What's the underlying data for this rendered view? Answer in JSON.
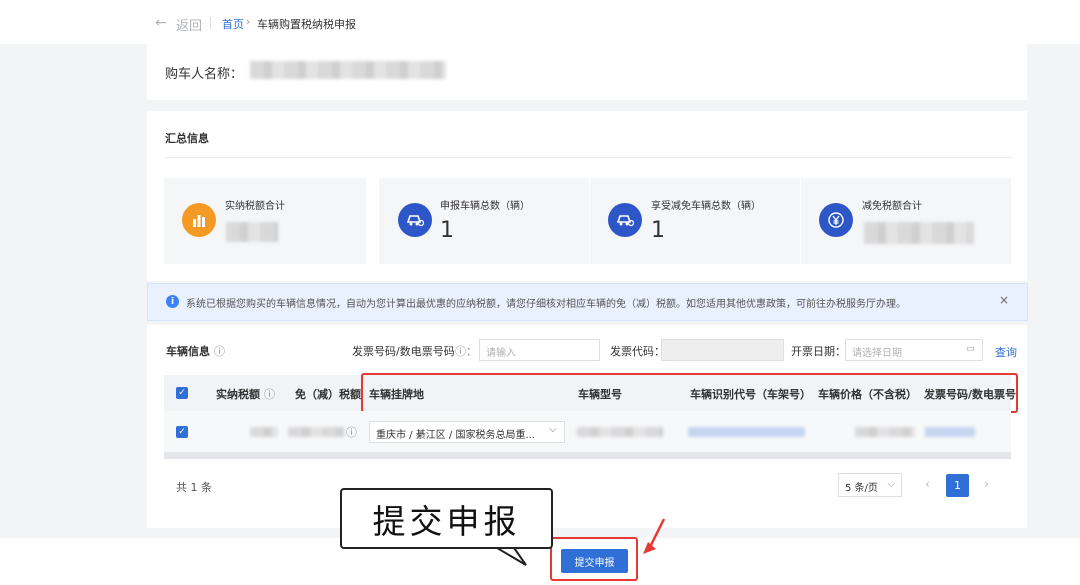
{
  "topbar": {
    "back_label": "返回",
    "breadcrumb": {
      "home": "首页",
      "separator": "›",
      "current": "车辆购置税纳税申报"
    }
  },
  "buyer": {
    "label": "购车人名称："
  },
  "summary": {
    "title": "汇总信息",
    "stats": [
      {
        "label": "实纳税额合计",
        "value": "",
        "icon": "chart-icon",
        "color": "#f39a24"
      },
      {
        "label": "申报车辆总数（辆）",
        "value": "1",
        "icon": "car-icon",
        "color": "#2d57c9"
      },
      {
        "label": "享受减免车辆总数（辆）",
        "value": "1",
        "icon": "car-discount-icon",
        "color": "#2d57c9"
      },
      {
        "label": "减免税额合计",
        "value": "",
        "icon": "yen-icon",
        "color": "#2d57c9"
      }
    ]
  },
  "notice": {
    "text": "系统已根据您购买的车辆信息情况，自动为您计算出最优惠的应纳税额，请您仔细核对相应车辆的免（减）税额。如您适用其他优惠政策，可前往办税服务厅办理。",
    "close": "×"
  },
  "vehicle": {
    "title": "车辆信息",
    "filters": {
      "invoice_no_label": "发票号码/数电票号码",
      "invoice_no_placeholder": "请输入",
      "invoice_code_label": "发票代码：",
      "date_label": "开票日期：",
      "date_placeholder": "请选择日期",
      "query": "查询"
    },
    "columns": [
      "实纳税额",
      "免（减）税额",
      "车辆挂牌地",
      "车辆型号",
      "车辆识别代号（车架号）",
      "车辆价格（不含税）",
      "发票号码/数电票号"
    ],
    "row": {
      "plate_location": "重庆市 / 綦江区 / 国家税务总局重..."
    },
    "total": "共 1 条",
    "page_size": "5 条/页",
    "current_page": "1"
  },
  "actions": {
    "submit": "提交申报"
  },
  "callout": {
    "text": "提交申报"
  }
}
